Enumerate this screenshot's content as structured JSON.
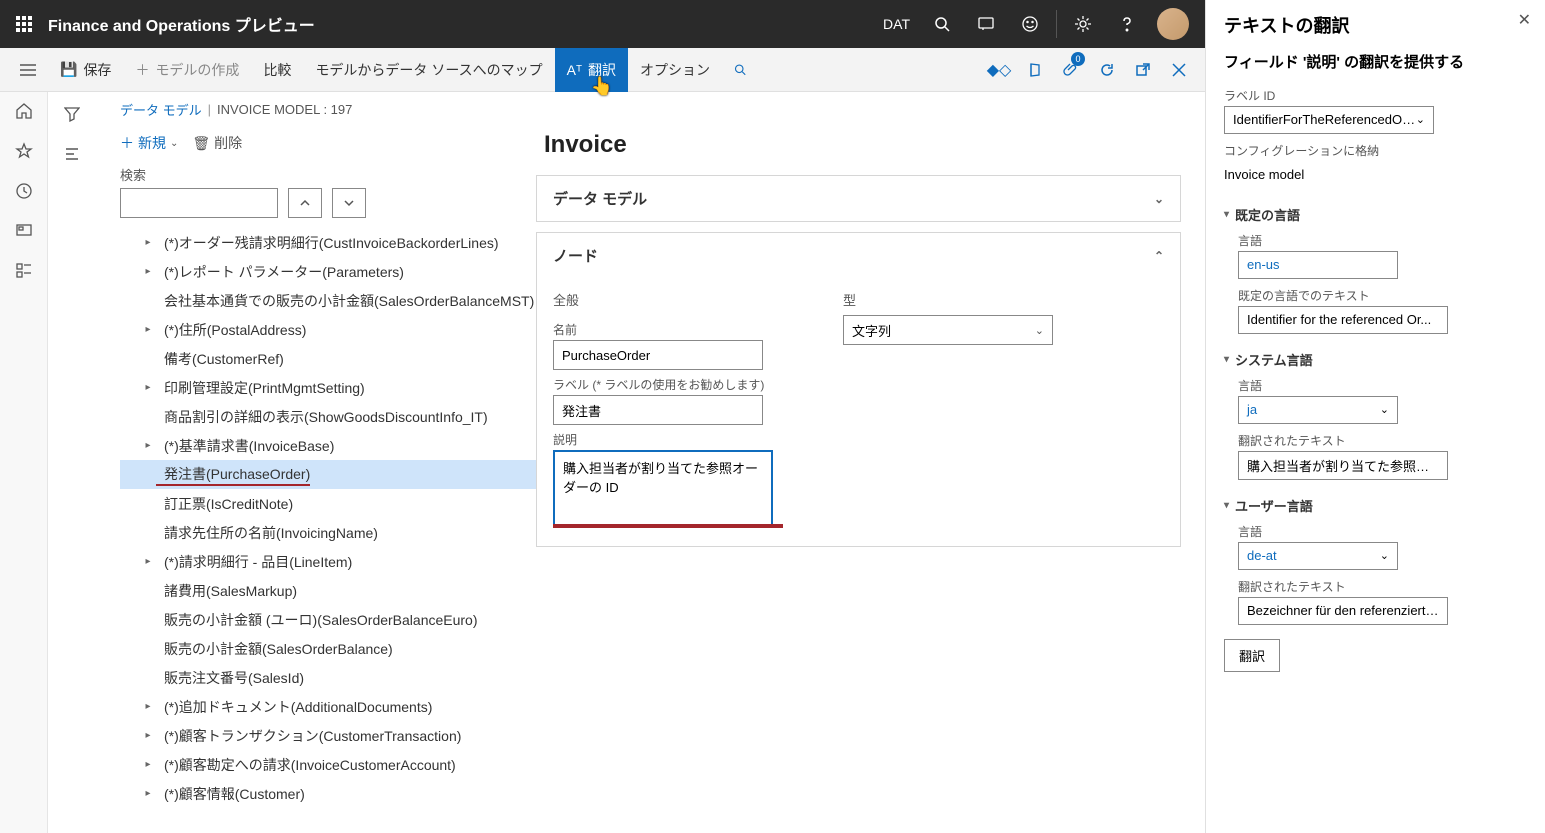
{
  "topbar": {
    "title": "Finance and Operations プレビュー",
    "company": "DAT"
  },
  "actionbar": {
    "save": "保存",
    "create_model": "モデルの作成",
    "compare": "比較",
    "map_sources": "モデルからデータ ソースへのマップ",
    "translate": "翻訳",
    "options": "オプション",
    "badge": "0"
  },
  "breadcrumb": {
    "link": "データ モデル",
    "current": "INVOICE MODEL : 197"
  },
  "treebar": {
    "new": "新規",
    "delete": "削除",
    "search_label": "検索"
  },
  "tree": [
    {
      "indent": 1,
      "caret": true,
      "label": "(*)オーダー残請求明細行(CustInvoiceBackorderLines)"
    },
    {
      "indent": 1,
      "caret": true,
      "label": "(*)レポート パラメーター(Parameters)"
    },
    {
      "indent": 1,
      "caret": false,
      "label": "会社基本通貨での販売の小計金額(SalesOrderBalanceMST)"
    },
    {
      "indent": 1,
      "caret": true,
      "label": "(*)住所(PostalAddress)"
    },
    {
      "indent": 1,
      "caret": false,
      "label": "備考(CustomerRef)"
    },
    {
      "indent": 1,
      "caret": true,
      "label": "印刷管理設定(PrintMgmtSetting)"
    },
    {
      "indent": 1,
      "caret": false,
      "label": "商品割引の詳細の表示(ShowGoodsDiscountInfo_IT)"
    },
    {
      "indent": 1,
      "caret": true,
      "label": "(*)基準請求書(InvoiceBase)"
    },
    {
      "indent": 1,
      "caret": false,
      "label": "発注書(PurchaseOrder)",
      "selected": true
    },
    {
      "indent": 1,
      "caret": false,
      "label": "訂正票(IsCreditNote)"
    },
    {
      "indent": 1,
      "caret": false,
      "label": "請求先住所の名前(InvoicingName)"
    },
    {
      "indent": 1,
      "caret": true,
      "label": "(*)請求明細行 - 品目(LineItem)"
    },
    {
      "indent": 1,
      "caret": false,
      "label": "諸費用(SalesMarkup)"
    },
    {
      "indent": 1,
      "caret": false,
      "label": "販売の小計金額 (ユーロ)(SalesOrderBalanceEuro)"
    },
    {
      "indent": 1,
      "caret": false,
      "label": "販売の小計金額(SalesOrderBalance)"
    },
    {
      "indent": 1,
      "caret": false,
      "label": "販売注文番号(SalesId)"
    },
    {
      "indent": 1,
      "caret": true,
      "label": "(*)追加ドキュメント(AdditionalDocuments)"
    },
    {
      "indent": 1,
      "caret": true,
      "label": "(*)顧客トランザクション(CustomerTransaction)"
    },
    {
      "indent": 1,
      "caret": true,
      "label": "(*)顧客勘定への請求(InvoiceCustomerAccount)"
    },
    {
      "indent": 1,
      "caret": true,
      "label": "(*)顧客情報(Customer)"
    }
  ],
  "main": {
    "heading": "Invoice",
    "section1": "データ モデル",
    "section2": "ノード",
    "general": "全般",
    "name_lbl": "名前",
    "name_val": "PurchaseOrder",
    "label_lbl": "ラベル (* ラベルの使用をお勧めします)",
    "label_val": "発注書",
    "desc_lbl": "説明",
    "desc_val": "購入担当者が割り当てた参照オーダーの ID",
    "type_grouplbl": "型",
    "type_val": "文字列"
  },
  "panel": {
    "title": "テキストの翻訳",
    "subtitle": "フィールド '説明' の翻訳を提供する",
    "labelid_lbl": "ラベル ID",
    "labelid_val": "IdentifierForTheReferencedOr...",
    "config_lbl": "コンフィグレーションに格納",
    "config_val": "Invoice model",
    "grp1": "既定の言語",
    "lang_lbl": "言語",
    "lang1": "en-us",
    "text1_lbl": "既定の言語でのテキスト",
    "text1_val": "Identifier for the referenced Or...",
    "grp2": "システム言語",
    "lang2": "ja",
    "text2_lbl": "翻訳されたテキスト",
    "text2_val": "購入担当者が割り当てた参照オ...",
    "grp3": "ユーザー言語",
    "lang3": "de-at",
    "text3_val": "Bezeichner für den referenzierte...",
    "translate_btn": "翻訳"
  }
}
